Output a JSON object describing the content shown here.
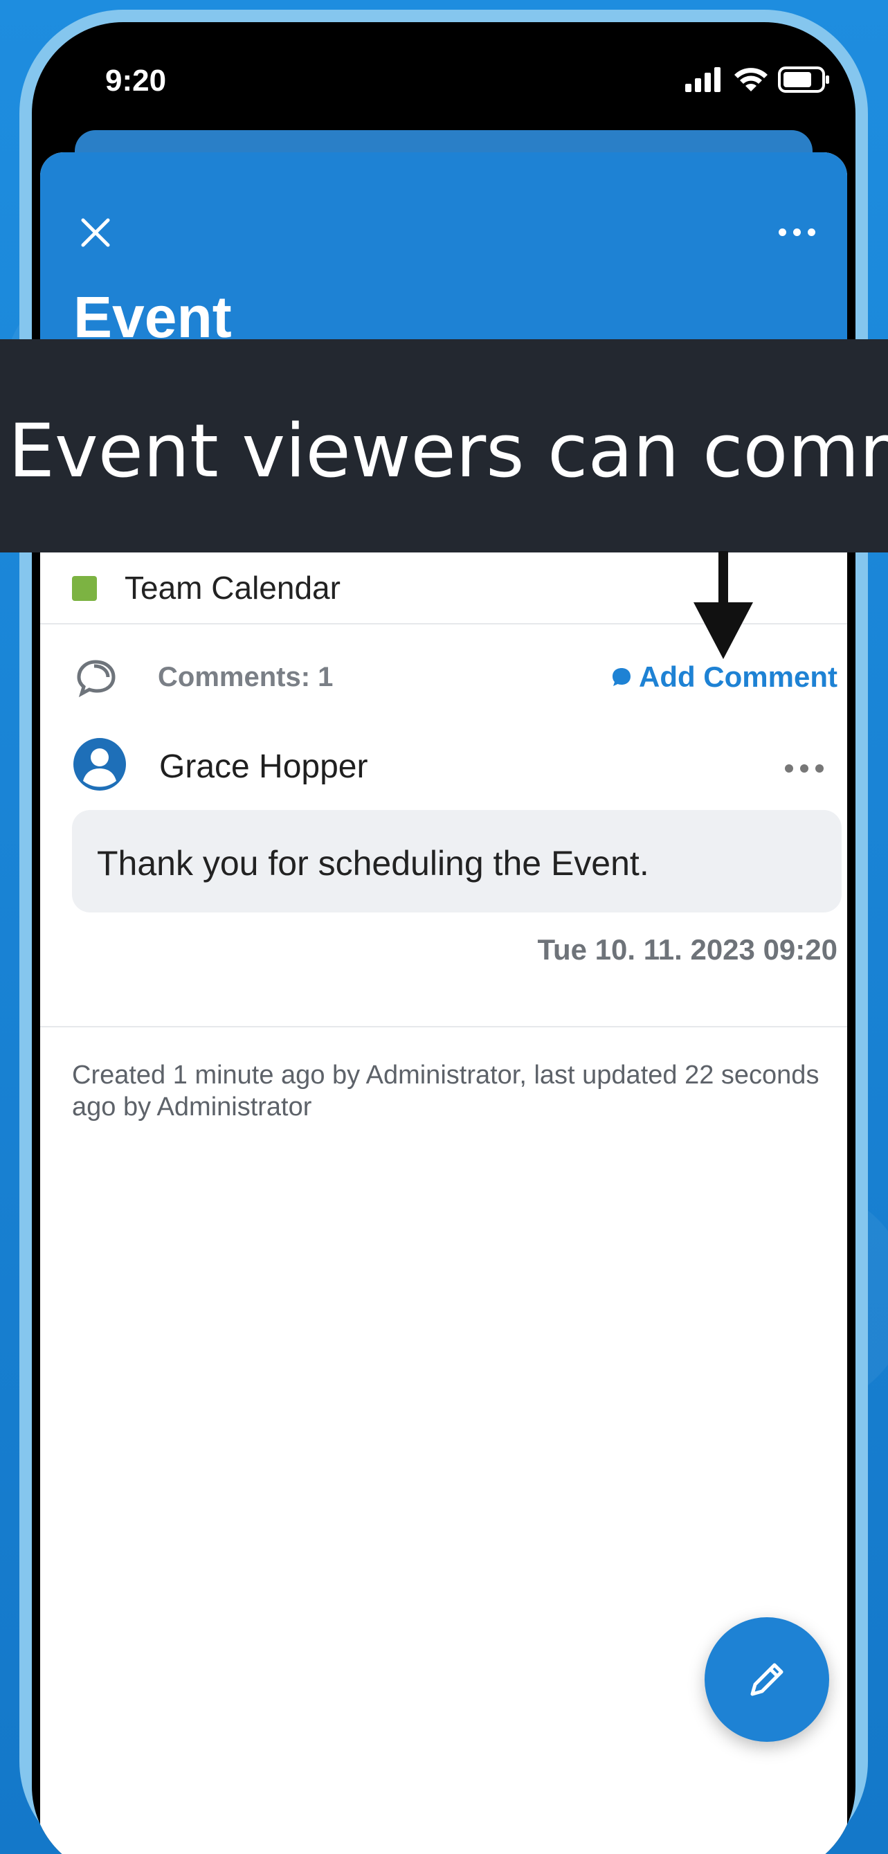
{
  "status_bar": {
    "time": "9:20",
    "icons": [
      "signal-icon",
      "wifi-icon",
      "battery-icon"
    ]
  },
  "header": {
    "title": "Event",
    "close_icon": "close-icon",
    "more_icon": "more-icon"
  },
  "banner": {
    "text": "Event viewers can comment"
  },
  "calendar": {
    "label": "Team Calendar",
    "color": "#7cb342"
  },
  "comments": {
    "count_label": "Comments: 1",
    "add_label": "Add Comment",
    "items": [
      {
        "author": "Grace Hopper",
        "text": "Thank you for scheduling the Event.",
        "timestamp": "Tue 10. 11. 2023 09:20"
      }
    ]
  },
  "meta": {
    "text": "Created 1 minute ago by Administrator, last updated 22 seconds ago by Administrator"
  },
  "fab": {
    "icon": "pencil-icon"
  },
  "colors": {
    "accent": "#1e82d4",
    "banner_bg": "#232830",
    "background": "#1b86d8"
  }
}
